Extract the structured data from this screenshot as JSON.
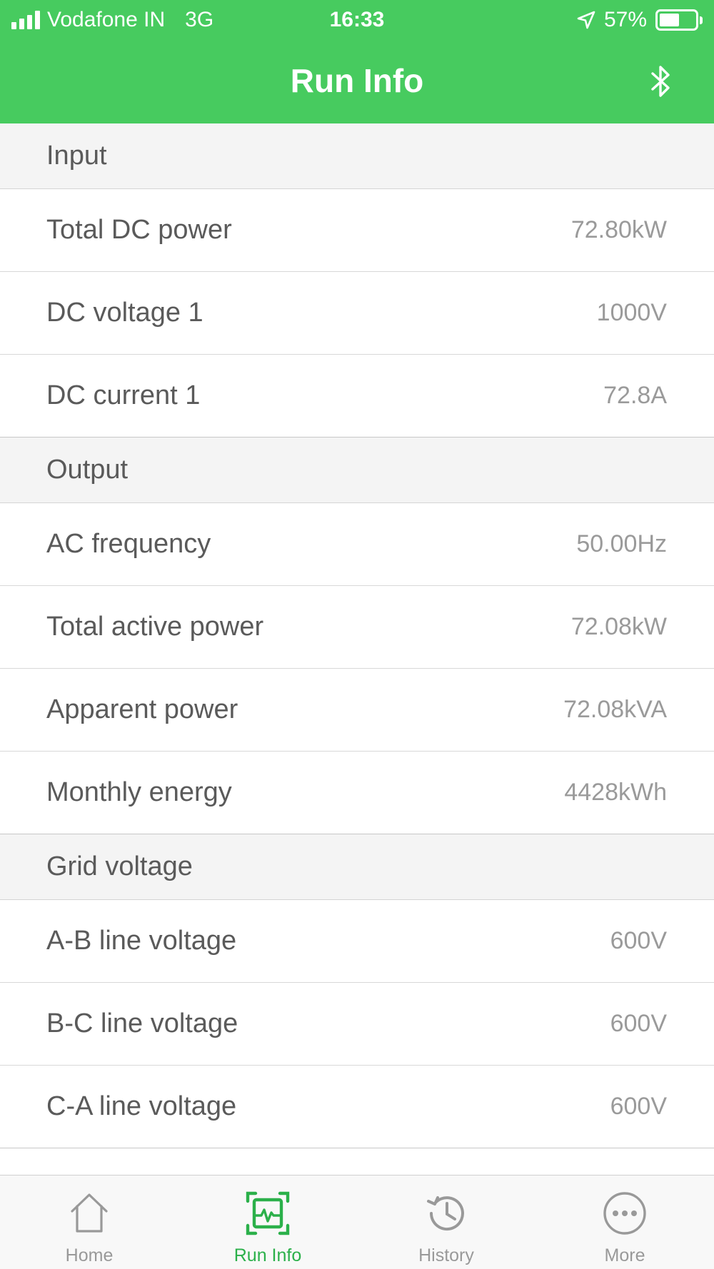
{
  "status_bar": {
    "carrier": "Vodafone IN",
    "network": "3G",
    "time": "16:33",
    "battery": "57%",
    "battery_level": 0.57
  },
  "nav": {
    "title": "Run Info",
    "right_icon": "bluetooth-icon"
  },
  "sections": [
    {
      "title": "Input",
      "rows": [
        {
          "label": "Total DC power",
          "value": "72.80kW"
        },
        {
          "label": "DC voltage 1",
          "value": "1000V"
        },
        {
          "label": "DC current 1",
          "value": "72.8A"
        }
      ]
    },
    {
      "title": "Output",
      "rows": [
        {
          "label": "AC frequency",
          "value": "50.00Hz"
        },
        {
          "label": "Total active power",
          "value": "72.08kW"
        },
        {
          "label": "Apparent power",
          "value": "72.08kVA"
        },
        {
          "label": "Monthly energy",
          "value": "4428kWh"
        }
      ]
    },
    {
      "title": "Grid voltage",
      "rows": [
        {
          "label": "A-B line voltage",
          "value": "600V"
        },
        {
          "label": "B-C line voltage",
          "value": "600V"
        },
        {
          "label": "C-A line voltage",
          "value": "600V"
        }
      ]
    }
  ],
  "tabs": [
    {
      "label": "Home",
      "icon": "home-icon",
      "active": false
    },
    {
      "label": "Run Info",
      "icon": "run-info-icon",
      "active": true
    },
    {
      "label": "History",
      "icon": "history-icon",
      "active": false
    },
    {
      "label": "More",
      "icon": "more-icon",
      "active": false
    }
  ],
  "colors": {
    "accent": "#47cb5f",
    "active_tab": "#2bb04a",
    "inactive_tab": "#999999",
    "section_bg": "#f4f4f4"
  }
}
